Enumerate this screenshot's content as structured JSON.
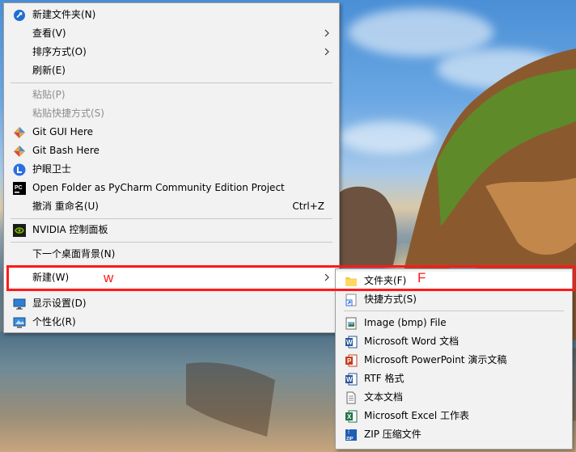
{
  "main_menu": {
    "items": [
      {
        "label": "新建文件夹(N)"
      },
      {
        "label": "查看(V)"
      },
      {
        "label": "排序方式(O)"
      },
      {
        "label": "刷新(E)"
      },
      {
        "label": "粘贴(P)"
      },
      {
        "label": "粘贴快捷方式(S)"
      },
      {
        "label": "Git GUI Here"
      },
      {
        "label": "Git Bash Here"
      },
      {
        "label": "护眼卫士"
      },
      {
        "label": "Open Folder as PyCharm Community Edition Project"
      },
      {
        "label": "撤消 重命名(U)",
        "shortcut": "Ctrl+Z"
      },
      {
        "label": "NVIDIA 控制面板"
      },
      {
        "label": "下一个桌面背景(N)"
      },
      {
        "label": "新建(W)"
      },
      {
        "label": "显示设置(D)"
      },
      {
        "label": "个性化(R)"
      }
    ]
  },
  "sub_menu": {
    "items": [
      {
        "label": "文件夹(F)"
      },
      {
        "label": "快捷方式(S)"
      },
      {
        "label": "Image (bmp) File"
      },
      {
        "label": "Microsoft Word 文档"
      },
      {
        "label": "Microsoft PowerPoint 演示文稿"
      },
      {
        "label": "RTF 格式"
      },
      {
        "label": "文本文档"
      },
      {
        "label": "Microsoft Excel 工作表"
      },
      {
        "label": "ZIP 压缩文件"
      }
    ]
  },
  "annotations": {
    "new_key": "w",
    "folder_key": "F",
    "color": "#ff1a1a"
  },
  "icons": {
    "new_folder": "new-folder-icon",
    "git_gui": "git-icon",
    "git_bash": "git-icon",
    "eye_guard": "eye-guard-icon",
    "pycharm": "pycharm-icon",
    "nvidia": "nvidia-icon",
    "display": "display-icon",
    "personalize": "personalize-icon",
    "folder": "folder-icon",
    "shortcut": "shortcut-icon",
    "bmp": "image-file-icon",
    "word": "word-icon",
    "powerpoint": "powerpoint-icon",
    "rtf": "rtf-icon",
    "text": "text-file-icon",
    "excel": "excel-icon",
    "zip": "zip-icon"
  }
}
